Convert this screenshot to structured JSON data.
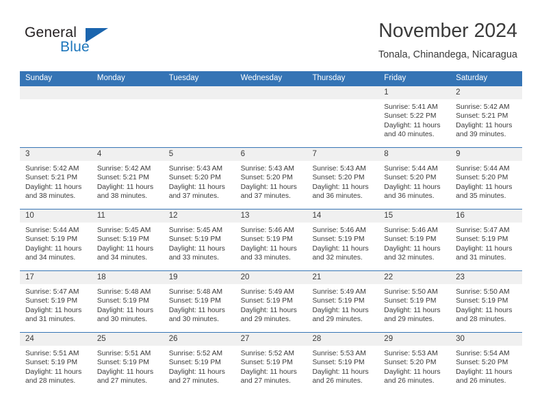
{
  "logo": {
    "word_one": "General",
    "word_two": "Blue",
    "triangle_icon": "triangle-icon"
  },
  "header": {
    "month_title": "November 2024",
    "location": "Tonala, Chinandega, Nicaragua"
  },
  "calendar": {
    "weekdays": [
      "Sunday",
      "Monday",
      "Tuesday",
      "Wednesday",
      "Thursday",
      "Friday",
      "Saturday"
    ],
    "accent_color": "#3574b5",
    "daynum_band_color": "#f0f0f0",
    "text_color": "#3a3a3a",
    "weeks": [
      [
        {
          "day": "",
          "sunrise": "",
          "sunset": "",
          "daylight_1": "",
          "daylight_2": ""
        },
        {
          "day": "",
          "sunrise": "",
          "sunset": "",
          "daylight_1": "",
          "daylight_2": ""
        },
        {
          "day": "",
          "sunrise": "",
          "sunset": "",
          "daylight_1": "",
          "daylight_2": ""
        },
        {
          "day": "",
          "sunrise": "",
          "sunset": "",
          "daylight_1": "",
          "daylight_2": ""
        },
        {
          "day": "",
          "sunrise": "",
          "sunset": "",
          "daylight_1": "",
          "daylight_2": ""
        },
        {
          "day": "1",
          "sunrise": "Sunrise: 5:41 AM",
          "sunset": "Sunset: 5:22 PM",
          "daylight_1": "Daylight: 11 hours",
          "daylight_2": "and 40 minutes."
        },
        {
          "day": "2",
          "sunrise": "Sunrise: 5:42 AM",
          "sunset": "Sunset: 5:21 PM",
          "daylight_1": "Daylight: 11 hours",
          "daylight_2": "and 39 minutes."
        }
      ],
      [
        {
          "day": "3",
          "sunrise": "Sunrise: 5:42 AM",
          "sunset": "Sunset: 5:21 PM",
          "daylight_1": "Daylight: 11 hours",
          "daylight_2": "and 38 minutes."
        },
        {
          "day": "4",
          "sunrise": "Sunrise: 5:42 AM",
          "sunset": "Sunset: 5:21 PM",
          "daylight_1": "Daylight: 11 hours",
          "daylight_2": "and 38 minutes."
        },
        {
          "day": "5",
          "sunrise": "Sunrise: 5:43 AM",
          "sunset": "Sunset: 5:20 PM",
          "daylight_1": "Daylight: 11 hours",
          "daylight_2": "and 37 minutes."
        },
        {
          "day": "6",
          "sunrise": "Sunrise: 5:43 AM",
          "sunset": "Sunset: 5:20 PM",
          "daylight_1": "Daylight: 11 hours",
          "daylight_2": "and 37 minutes."
        },
        {
          "day": "7",
          "sunrise": "Sunrise: 5:43 AM",
          "sunset": "Sunset: 5:20 PM",
          "daylight_1": "Daylight: 11 hours",
          "daylight_2": "and 36 minutes."
        },
        {
          "day": "8",
          "sunrise": "Sunrise: 5:44 AM",
          "sunset": "Sunset: 5:20 PM",
          "daylight_1": "Daylight: 11 hours",
          "daylight_2": "and 36 minutes."
        },
        {
          "day": "9",
          "sunrise": "Sunrise: 5:44 AM",
          "sunset": "Sunset: 5:20 PM",
          "daylight_1": "Daylight: 11 hours",
          "daylight_2": "and 35 minutes."
        }
      ],
      [
        {
          "day": "10",
          "sunrise": "Sunrise: 5:44 AM",
          "sunset": "Sunset: 5:19 PM",
          "daylight_1": "Daylight: 11 hours",
          "daylight_2": "and 34 minutes."
        },
        {
          "day": "11",
          "sunrise": "Sunrise: 5:45 AM",
          "sunset": "Sunset: 5:19 PM",
          "daylight_1": "Daylight: 11 hours",
          "daylight_2": "and 34 minutes."
        },
        {
          "day": "12",
          "sunrise": "Sunrise: 5:45 AM",
          "sunset": "Sunset: 5:19 PM",
          "daylight_1": "Daylight: 11 hours",
          "daylight_2": "and 33 minutes."
        },
        {
          "day": "13",
          "sunrise": "Sunrise: 5:46 AM",
          "sunset": "Sunset: 5:19 PM",
          "daylight_1": "Daylight: 11 hours",
          "daylight_2": "and 33 minutes."
        },
        {
          "day": "14",
          "sunrise": "Sunrise: 5:46 AM",
          "sunset": "Sunset: 5:19 PM",
          "daylight_1": "Daylight: 11 hours",
          "daylight_2": "and 32 minutes."
        },
        {
          "day": "15",
          "sunrise": "Sunrise: 5:46 AM",
          "sunset": "Sunset: 5:19 PM",
          "daylight_1": "Daylight: 11 hours",
          "daylight_2": "and 32 minutes."
        },
        {
          "day": "16",
          "sunrise": "Sunrise: 5:47 AM",
          "sunset": "Sunset: 5:19 PM",
          "daylight_1": "Daylight: 11 hours",
          "daylight_2": "and 31 minutes."
        }
      ],
      [
        {
          "day": "17",
          "sunrise": "Sunrise: 5:47 AM",
          "sunset": "Sunset: 5:19 PM",
          "daylight_1": "Daylight: 11 hours",
          "daylight_2": "and 31 minutes."
        },
        {
          "day": "18",
          "sunrise": "Sunrise: 5:48 AM",
          "sunset": "Sunset: 5:19 PM",
          "daylight_1": "Daylight: 11 hours",
          "daylight_2": "and 30 minutes."
        },
        {
          "day": "19",
          "sunrise": "Sunrise: 5:48 AM",
          "sunset": "Sunset: 5:19 PM",
          "daylight_1": "Daylight: 11 hours",
          "daylight_2": "and 30 minutes."
        },
        {
          "day": "20",
          "sunrise": "Sunrise: 5:49 AM",
          "sunset": "Sunset: 5:19 PM",
          "daylight_1": "Daylight: 11 hours",
          "daylight_2": "and 29 minutes."
        },
        {
          "day": "21",
          "sunrise": "Sunrise: 5:49 AM",
          "sunset": "Sunset: 5:19 PM",
          "daylight_1": "Daylight: 11 hours",
          "daylight_2": "and 29 minutes."
        },
        {
          "day": "22",
          "sunrise": "Sunrise: 5:50 AM",
          "sunset": "Sunset: 5:19 PM",
          "daylight_1": "Daylight: 11 hours",
          "daylight_2": "and 29 minutes."
        },
        {
          "day": "23",
          "sunrise": "Sunrise: 5:50 AM",
          "sunset": "Sunset: 5:19 PM",
          "daylight_1": "Daylight: 11 hours",
          "daylight_2": "and 28 minutes."
        }
      ],
      [
        {
          "day": "24",
          "sunrise": "Sunrise: 5:51 AM",
          "sunset": "Sunset: 5:19 PM",
          "daylight_1": "Daylight: 11 hours",
          "daylight_2": "and 28 minutes."
        },
        {
          "day": "25",
          "sunrise": "Sunrise: 5:51 AM",
          "sunset": "Sunset: 5:19 PM",
          "daylight_1": "Daylight: 11 hours",
          "daylight_2": "and 27 minutes."
        },
        {
          "day": "26",
          "sunrise": "Sunrise: 5:52 AM",
          "sunset": "Sunset: 5:19 PM",
          "daylight_1": "Daylight: 11 hours",
          "daylight_2": "and 27 minutes."
        },
        {
          "day": "27",
          "sunrise": "Sunrise: 5:52 AM",
          "sunset": "Sunset: 5:19 PM",
          "daylight_1": "Daylight: 11 hours",
          "daylight_2": "and 27 minutes."
        },
        {
          "day": "28",
          "sunrise": "Sunrise: 5:53 AM",
          "sunset": "Sunset: 5:19 PM",
          "daylight_1": "Daylight: 11 hours",
          "daylight_2": "and 26 minutes."
        },
        {
          "day": "29",
          "sunrise": "Sunrise: 5:53 AM",
          "sunset": "Sunset: 5:20 PM",
          "daylight_1": "Daylight: 11 hours",
          "daylight_2": "and 26 minutes."
        },
        {
          "day": "30",
          "sunrise": "Sunrise: 5:54 AM",
          "sunset": "Sunset: 5:20 PM",
          "daylight_1": "Daylight: 11 hours",
          "daylight_2": "and 26 minutes."
        }
      ]
    ]
  }
}
